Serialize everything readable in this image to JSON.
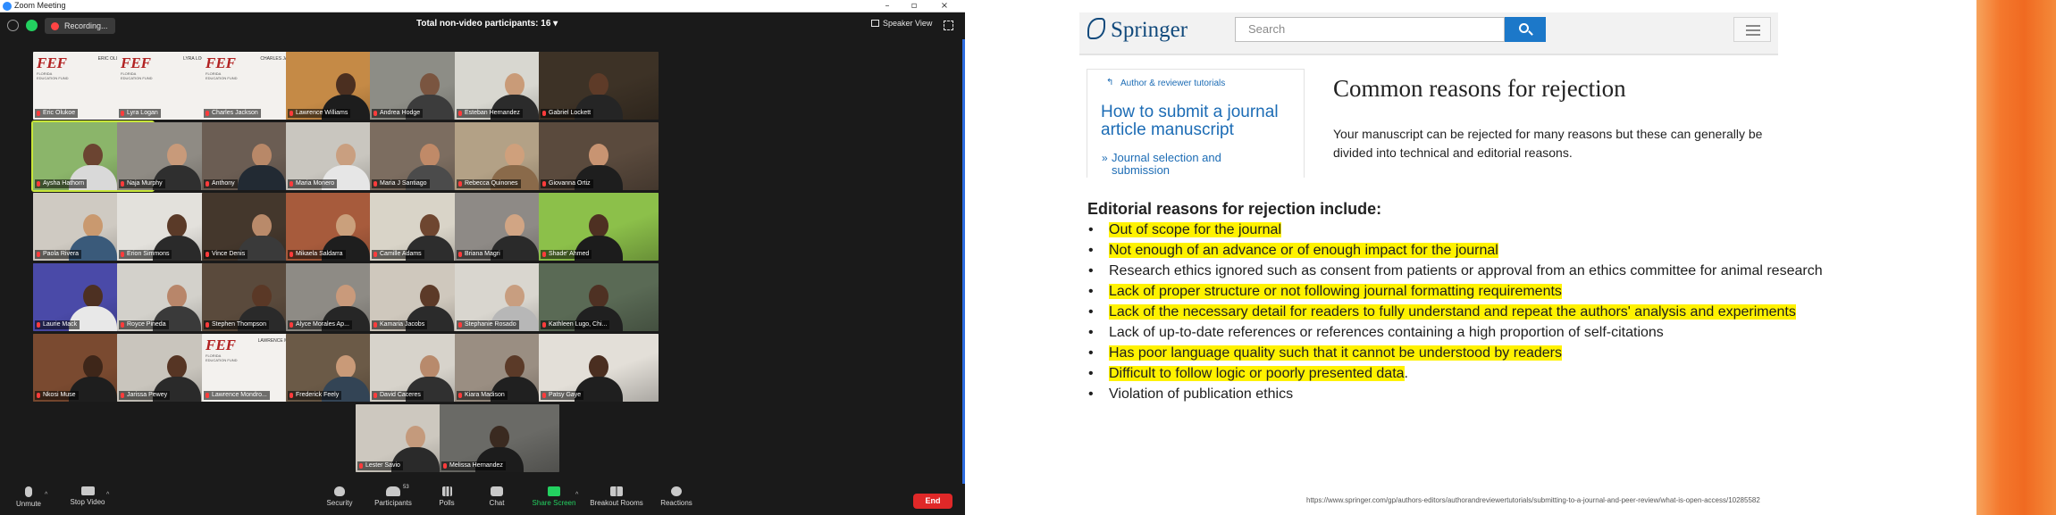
{
  "zoom": {
    "window_title": "Zoom Meeting",
    "recording_label": "Recording...",
    "participants_label": "Total non-video participants: 16",
    "speaker_view_label": "Speaker View",
    "participant_count": "53",
    "toolbar": {
      "unmute": "Unmute",
      "stop_video": "Stop Video",
      "security": "Security",
      "participants": "Participants",
      "polls": "Polls",
      "chat": "Chat",
      "share_screen": "Share Screen",
      "breakout_rooms": "Breakout Rooms",
      "reactions": "Reactions",
      "end": "End"
    },
    "tiles": [
      {
        "name": "Eric Olukoe",
        "style": "fef",
        "fef_name": "ERIC OLUKOE, MD"
      },
      {
        "name": "Lyra Logan",
        "style": "fef",
        "fef_name": "LYRA LOGAN, MD"
      },
      {
        "name": "Charles Jackson",
        "style": "fef",
        "fef_name": "CHARLES JACKSON, MD"
      },
      {
        "name": "Lawrence Williams",
        "bg": "#c58a46",
        "skin": "#4b2f20",
        "shirt": "#1d1d1d"
      },
      {
        "name": "Andrea Hodge",
        "bg": "#8d8d86",
        "skin": "#7a5540",
        "shirt": "#3c3c3c"
      },
      {
        "name": "Esteban Hernandez",
        "bg": "#d8d7d0",
        "skin": "#c99b78",
        "shirt": "#2b2b2b"
      },
      {
        "name": "Gabriel Lockett",
        "bg": "#3d3226",
        "skin": "#5e3b28",
        "shirt": "#252525"
      },
      {
        "name": "Aysha Hathorn",
        "bg": "#8bb56a",
        "skin": "#6b4431",
        "shirt": "#d9d9d9",
        "active": true
      },
      {
        "name": "Naja Murphy",
        "bg": "#8f8b84",
        "skin": "#c89a7a",
        "shirt": "#2f2f2f"
      },
      {
        "name": "Anthony",
        "bg": "#6b5d53",
        "skin": "#b88868",
        "shirt": "#222a33"
      },
      {
        "name": "Maria Monero",
        "bg": "#c9c6bf",
        "skin": "#c99f80",
        "shirt": "#e6e6e6"
      },
      {
        "name": "Maria J Santiago",
        "bg": "#7c6d60",
        "skin": "#c08a68",
        "shirt": "#4b4b4b"
      },
      {
        "name": "Rebecca Quinones",
        "bg": "#b3a186",
        "skin": "#cfa07c",
        "shirt": "#8a6a4a"
      },
      {
        "name": "Giovanna Ortiz",
        "bg": "#5a4a3d",
        "skin": "#c89472",
        "shirt": "#1e1e1e"
      },
      {
        "name": "Paola Rivera",
        "bg": "#cfcac2",
        "skin": "#c9996f",
        "shirt": "#3a5a7a"
      },
      {
        "name": "Erion Simmons",
        "bg": "#e3e1dc",
        "skin": "#5a3a28",
        "shirt": "#2a2a2a"
      },
      {
        "name": "Vince Denis",
        "bg": "#44372c",
        "skin": "#b98a6a",
        "shirt": "#3a3a3a"
      },
      {
        "name": "Mikaela Saldarra",
        "bg": "#a75b3c",
        "skin": "#caa07c",
        "shirt": "#1e1e1e"
      },
      {
        "name": "Camille Adams",
        "bg": "#d9d4c8",
        "skin": "#6e4630",
        "shirt": "#2d2d2d"
      },
      {
        "name": "Briana Magri",
        "bg": "#8e8a86",
        "skin": "#d1a584",
        "shirt": "#2a2a2a"
      },
      {
        "name": "Shade' Ahmed",
        "bg": "#8cc04a",
        "skin": "#4e3022",
        "shirt": "#1c1c1c"
      },
      {
        "name": "Laurie Mack",
        "bg": "#4a4aa8",
        "skin": "#4d3022",
        "shirt": "#e8e8e8"
      },
      {
        "name": "Royce Pineda",
        "bg": "#d3d1cb",
        "skin": "#b8866a",
        "shirt": "#3a3a3a"
      },
      {
        "name": "Stephen Thompson",
        "bg": "#5a4a3c",
        "skin": "#5a3826",
        "shirt": "#2a2a2a"
      },
      {
        "name": "Alyce Morales Ap...",
        "bg": "#8e8b85",
        "skin": "#c99a7b",
        "shirt": "#262626"
      },
      {
        "name": "Kamaria Jacobs",
        "bg": "#cfc8bd",
        "skin": "#5c3a28",
        "shirt": "#2b2b2b"
      },
      {
        "name": "Stephanie Rosado",
        "bg": "#d9d6cf",
        "skin": "#c89e80",
        "shirt": "#b7b7b7"
      },
      {
        "name": "Kathleen Lugo, Chi...",
        "bg": "#5a6a55",
        "skin": "#4e3123",
        "shirt": "#202020"
      },
      {
        "name": "Nkosi Muse",
        "bg": "#7a4a30",
        "skin": "#3e2619",
        "shirt": "#1e1e1e"
      },
      {
        "name": "Jarissa Pewey",
        "bg": "#c9c5bd",
        "skin": "#563524",
        "shirt": "#2a2a2a"
      },
      {
        "name": "Lawrence Mondro...",
        "style": "fef",
        "fef_name": "LAWRENCE MONDRO, PhD"
      },
      {
        "name": "Frederick Feely",
        "bg": "#6b5a47",
        "skin": "#c99a78",
        "shirt": "#334455"
      },
      {
        "name": "David Caceres",
        "bg": "#d7d3cb",
        "skin": "#b88a6c",
        "shirt": "#303030"
      },
      {
        "name": "Kiara Madison",
        "bg": "#9a8e82",
        "skin": "#5b3a28",
        "shirt": "#202020"
      },
      {
        "name": "Patsy Gaye",
        "bg": "#e3dfd8",
        "skin": "#4a2e20",
        "shirt": "#1f1f1f"
      },
      {
        "name": "Lester Savio",
        "bg": "#cdc8bf",
        "skin": "#c49a7c",
        "shirt": "#2a2a2a"
      },
      {
        "name": "Melissa Hernandez",
        "bg": "#6a6a66",
        "skin": "#3a2a20",
        "shirt": "#1c1c1c"
      }
    ],
    "fef_sublabel": "FLORIDA EDUCATION FUND"
  },
  "slide": {
    "springer_logo": "Springer",
    "search_placeholder": "Search",
    "breadcrumb": "Author & reviewer tutorials",
    "tutorial_title": "How to submit a journal article manuscript",
    "tutorial_link": "Journal selection and submission",
    "heading": "Common reasons for rejection",
    "intro": "Your manuscript can be rejected for many reasons but these can generally be divided into technical and editorial reasons.",
    "editorial_heading": "Editorial reasons for rejection include:",
    "reasons": [
      {
        "text": "Out of scope for the journal",
        "highlight": true
      },
      {
        "text": "Not enough of an advance or of enough impact for the journal",
        "highlight": true
      },
      {
        "text": "Research ethics ignored such as consent from patients or approval from an ethics committee for animal research",
        "highlight": false
      },
      {
        "text": "Lack of proper structure or not following journal formatting requirements",
        "highlight": true
      },
      {
        "text": "Lack of the necessary detail for readers to fully understand and repeat the authors' analysis and experiments",
        "highlight": true
      },
      {
        "text": "Lack of up-to-date references or references containing a high proportion of self-citations",
        "highlight": false
      },
      {
        "text": "Has poor language quality such that it cannot be understood by readers",
        "highlight": true
      },
      {
        "text": "Difficult to follow logic or poorly presented data",
        "highlight": true,
        "suffix": "."
      },
      {
        "text": "Violation of publication ethics",
        "highlight": false
      }
    ],
    "source_url": "https://www.springer.com/gp/authors-editors/authorandreviewertutorials/submitting-to-a-journal-and-peer-review/what-is-open-access/10285582",
    "highlight_color": "#fff200",
    "link_color": "#1c6cb5",
    "accent_orange": "#f06a21"
  }
}
